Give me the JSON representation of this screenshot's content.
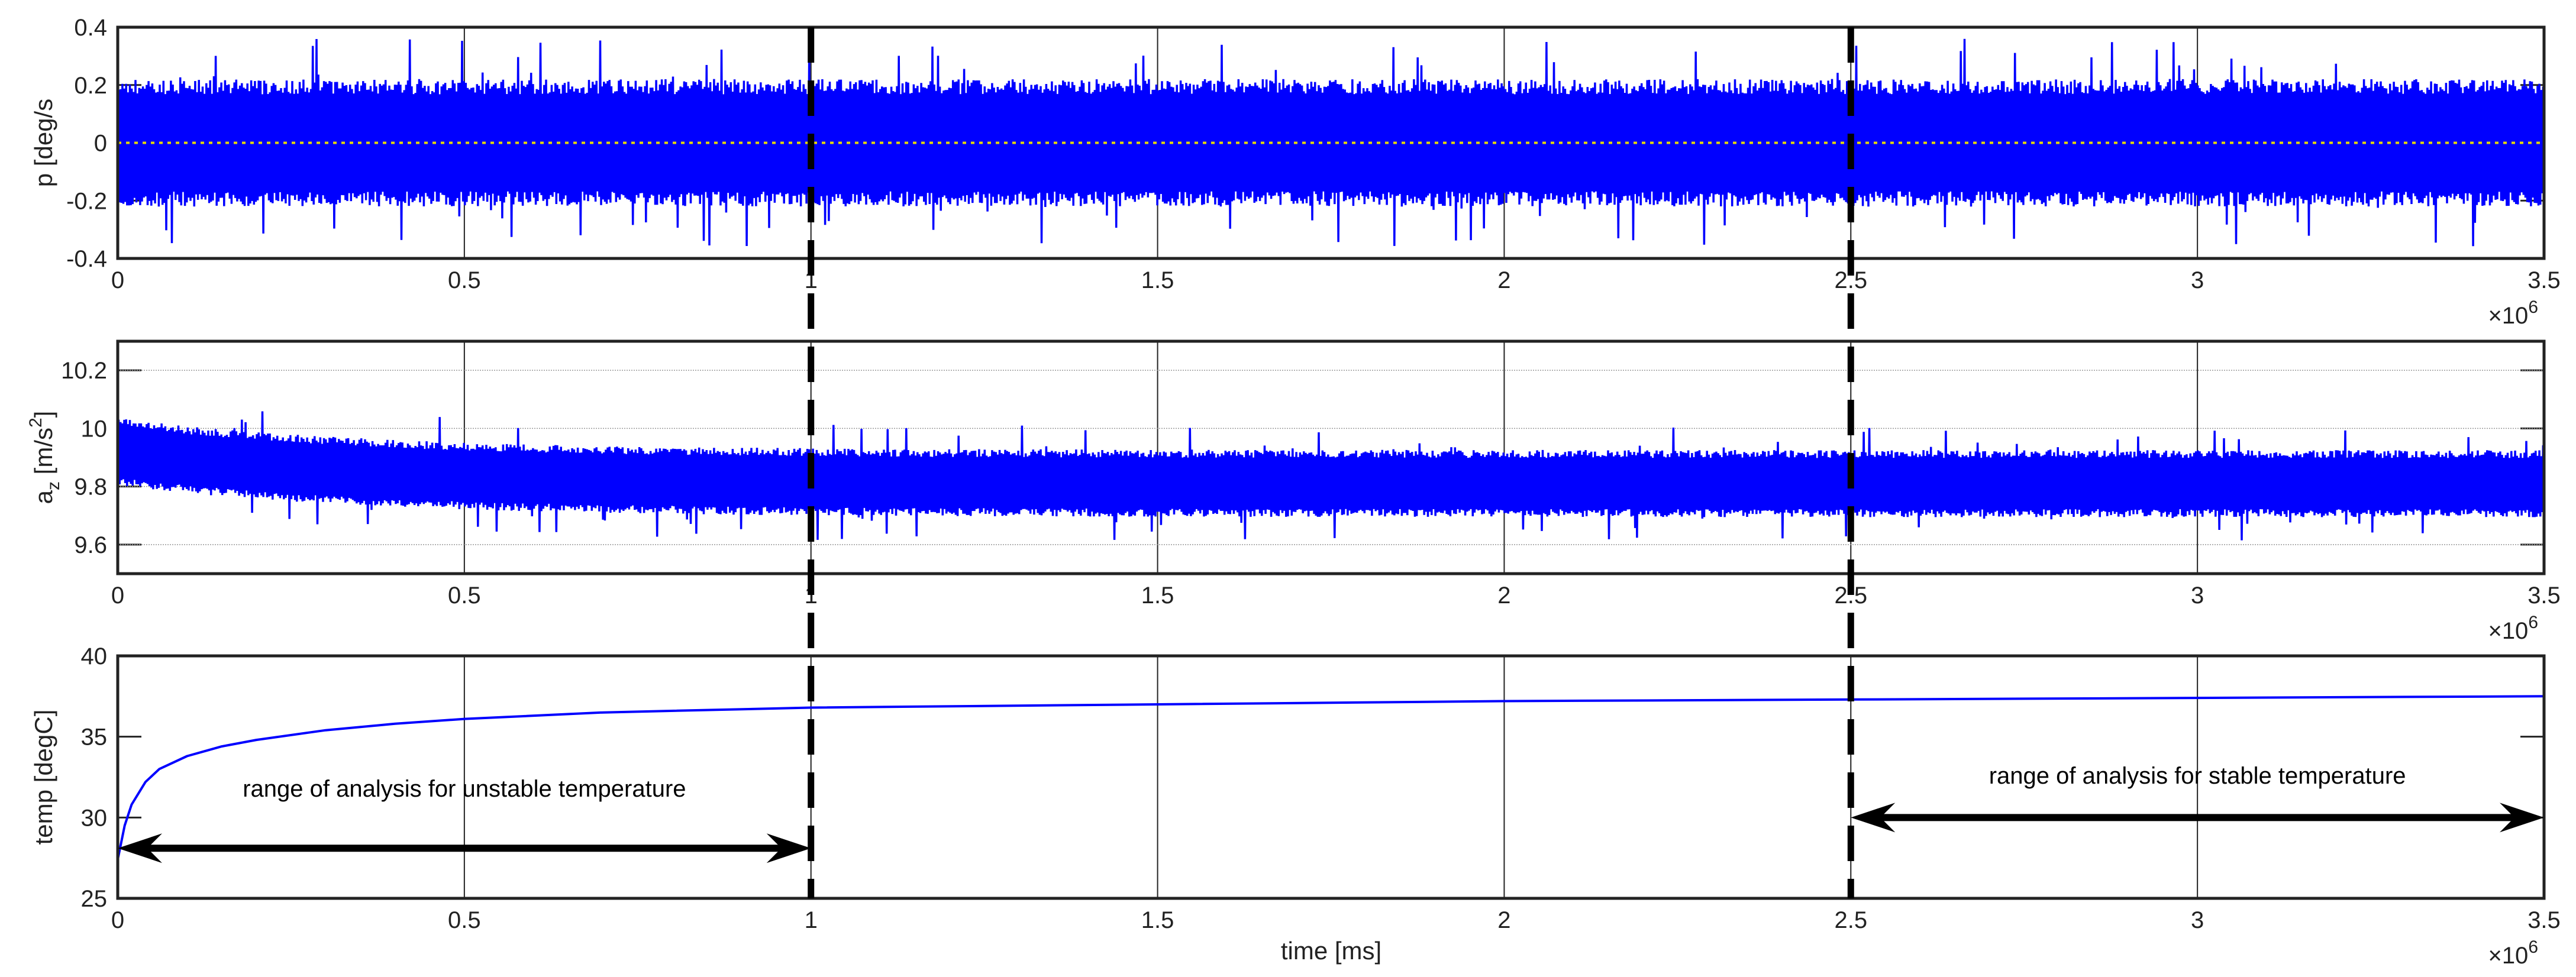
{
  "chart_data": [
    {
      "type": "line",
      "id": "p",
      "ylabel": "p [deg/s",
      "xlabel": "",
      "xlim": [
        0,
        3.5
      ],
      "ylim": [
        -0.4,
        0.4
      ],
      "x_ticks": [
        "0",
        "0.5",
        "1",
        "1.5",
        "2",
        "2.5",
        "3",
        "3.5"
      ],
      "y_ticks": [
        {
          "v": 0.4,
          "label": "0.4"
        },
        {
          "v": 0.2,
          "label": "0.2"
        },
        {
          "v": 0,
          "label": "0"
        },
        {
          "v": -0.2,
          "label": "-0.2"
        },
        {
          "v": -0.4,
          "label": "-0.4"
        }
      ],
      "x_multiplier": "×10",
      "x_exponent": "6",
      "grid": true,
      "reference_line": {
        "y": 0,
        "color": "#e6d800",
        "style": "dotted"
      },
      "series": [
        {
          "name": "p",
          "color": "#0000ff",
          "kind": "noise",
          "mean_start": 0,
          "mean_end": 0,
          "amplitude": 0.21,
          "peak": 0.36
        }
      ]
    },
    {
      "type": "line",
      "id": "az",
      "ylabel": "a",
      "ylabel_sub": "z",
      "ylabel_unit": "[m/s",
      "ylabel_sup": "2",
      "ylabel_close": "]",
      "xlim": [
        0,
        3.5
      ],
      "ylim": [
        9.5,
        10.3
      ],
      "x_ticks": [
        "0",
        "0.5",
        "1",
        "1.5",
        "2",
        "2.5",
        "3",
        "3.5"
      ],
      "y_ticks": [
        {
          "v": 10.2,
          "label": "10.2"
        },
        {
          "v": 10,
          "label": "10"
        },
        {
          "v": 9.8,
          "label": "9.8"
        },
        {
          "v": 9.6,
          "label": "9.6"
        }
      ],
      "x_multiplier": "×10",
      "x_exponent": "6",
      "grid": true,
      "series": [
        {
          "name": "a_z",
          "color": "#0000ff",
          "kind": "noise",
          "mean_start": 9.92,
          "mean_end": 9.81,
          "amplitude": 0.11,
          "peak": 0.2
        }
      ]
    },
    {
      "type": "line",
      "id": "temp",
      "ylabel": "temp [degC]",
      "xlabel": "time [ms]",
      "xlim": [
        0,
        3.5
      ],
      "ylim": [
        25,
        40
      ],
      "x_ticks": [
        "0",
        "0.5",
        "1",
        "1.5",
        "2",
        "2.5",
        "3",
        "3.5"
      ],
      "y_ticks": [
        {
          "v": 40,
          "label": "40"
        },
        {
          "v": 35,
          "label": "35"
        },
        {
          "v": 30,
          "label": "30"
        },
        {
          "v": 25,
          "label": "25"
        }
      ],
      "x_multiplier": "×10",
      "x_exponent": "6",
      "grid": true,
      "series": [
        {
          "name": "temp",
          "color": "#0000ff",
          "x": [
            0,
            0.01,
            0.02,
            0.04,
            0.06,
            0.1,
            0.15,
            0.2,
            0.3,
            0.4,
            0.5,
            0.7,
            1.0,
            1.5,
            2.0,
            2.5,
            3.0,
            3.5
          ],
          "y": [
            27.4,
            29.5,
            30.8,
            32.2,
            33.0,
            33.8,
            34.4,
            34.8,
            35.4,
            35.8,
            36.1,
            36.5,
            36.8,
            37.0,
            37.2,
            37.3,
            37.4,
            37.5
          ]
        }
      ],
      "annotations": [
        {
          "text": "range of analysis for unstable temperature",
          "text_x": 0.5,
          "text_y": 31.3,
          "arrow_from": 0,
          "arrow_to": 1.0,
          "arrow_y": 28.1
        },
        {
          "text": "range of analysis for stable temperature",
          "text_x": 3.0,
          "text_y": 32.1,
          "arrow_from": 2.5,
          "arrow_to": 3.5,
          "arrow_y": 30.0
        }
      ]
    }
  ],
  "markers": {
    "dashed_lines_x": [
      1.0,
      2.5
    ]
  }
}
